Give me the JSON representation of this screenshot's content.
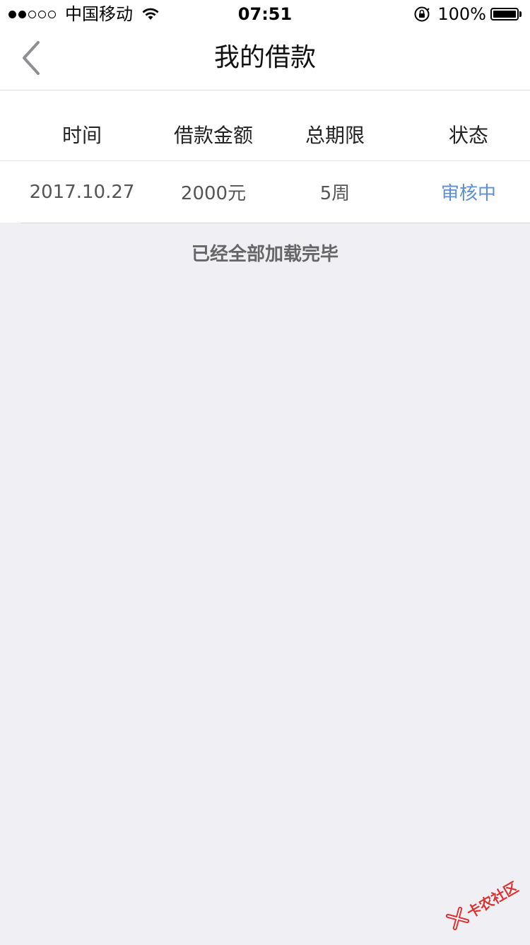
{
  "status_bar": {
    "carrier": "中国移动",
    "time": "07:51",
    "battery": "100%"
  },
  "nav": {
    "title": "我的借款"
  },
  "table": {
    "headers": [
      "时间",
      "借款金额",
      "总期限",
      "状态"
    ],
    "rows": [
      {
        "date": "2017.10.27",
        "amount": "2000元",
        "term": "5周",
        "status": "审核中"
      }
    ]
  },
  "footer_text": "已经全部加载完毕",
  "watermark": {
    "text": "卡农社区"
  },
  "colors": {
    "background": "#efeff4",
    "status_pending": "#5b8fd6",
    "watermark": "#e03030"
  }
}
